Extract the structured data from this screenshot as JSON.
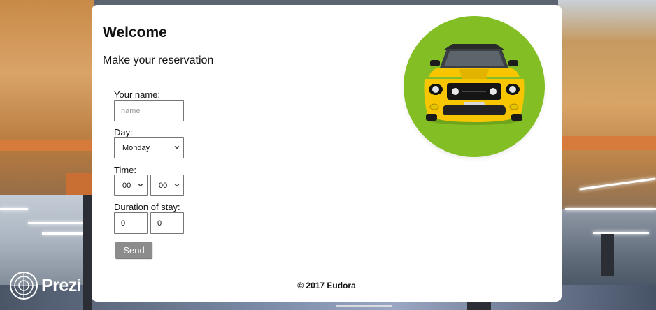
{
  "card": {
    "title": "Welcome",
    "subtitle": "Make your reservation"
  },
  "form": {
    "name_label": "Your name:",
    "name_placeholder": "name",
    "name_value": "",
    "day_label": "Day:",
    "day_value": "Monday",
    "time_label": "Time:",
    "time_hour": "00",
    "time_minute": "00",
    "duration_label": "Duration of stay:",
    "duration_first": "0",
    "duration_second": "0",
    "send_label": "Send"
  },
  "footer": {
    "text": "© 2017 Eudora"
  },
  "brand": {
    "logo_text": "Prezi"
  },
  "colors": {
    "accent_circle": "#83bf24",
    "car_body": "#f7c600",
    "button": "#8c8c8c"
  },
  "icons": {
    "chevron": "chevron-down-icon",
    "car": "car-image",
    "logo": "prezi-logo-icon"
  }
}
